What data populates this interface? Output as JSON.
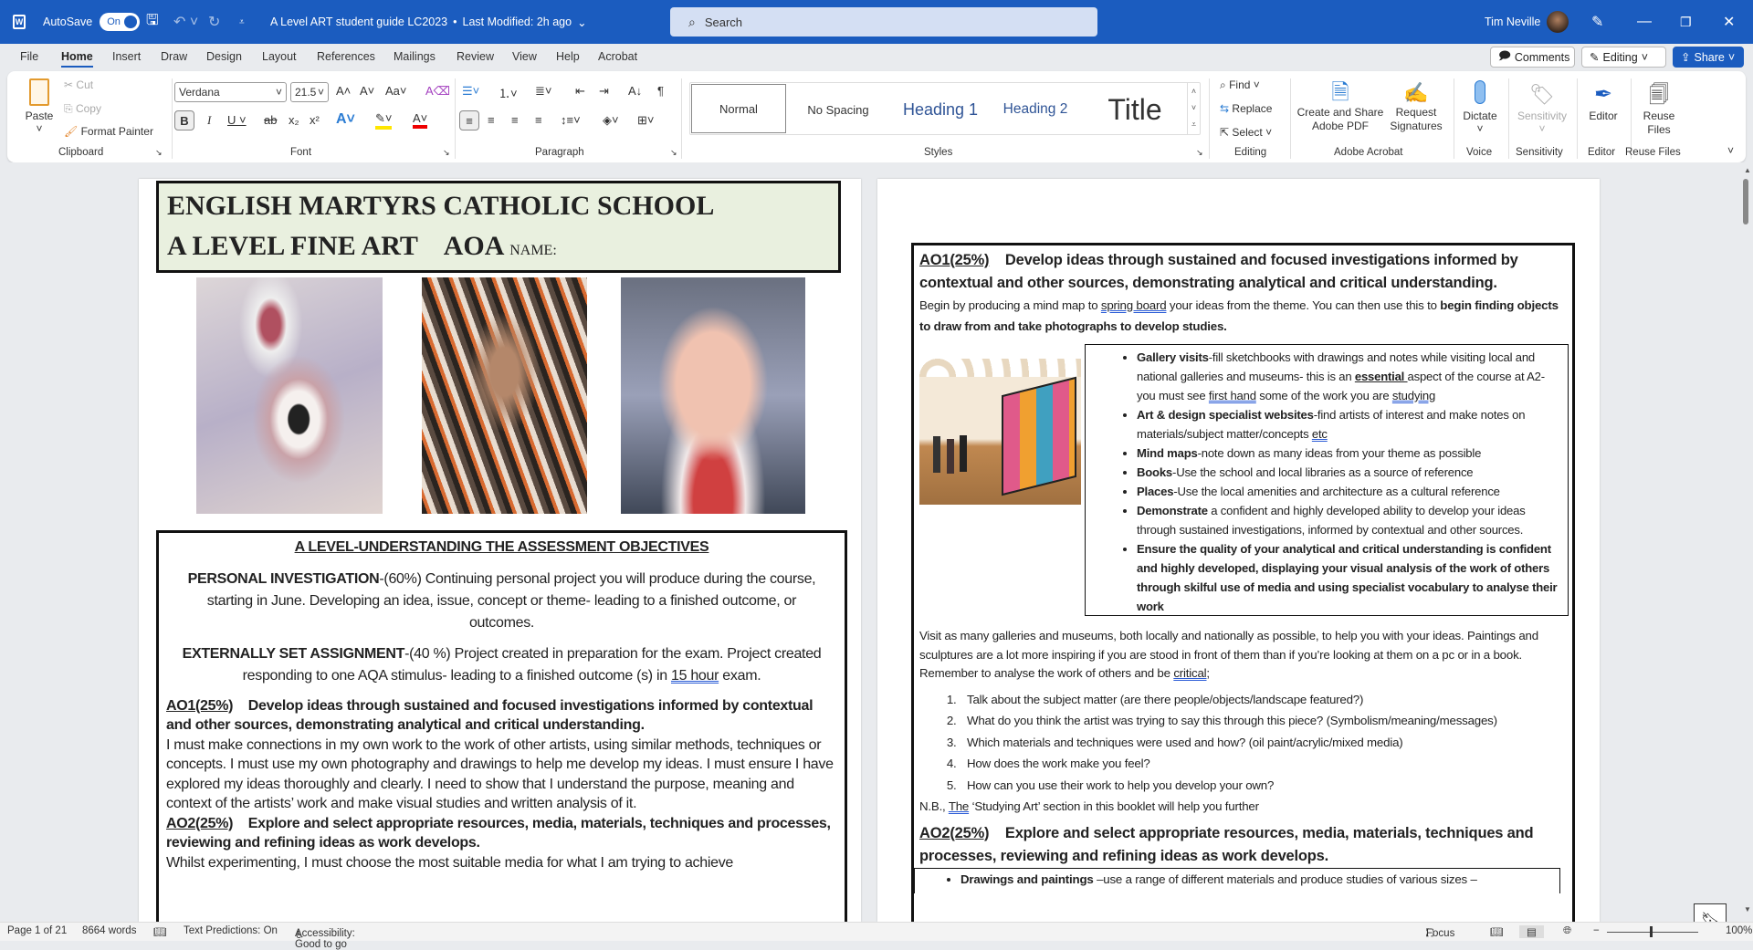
{
  "titlebar": {
    "autosave_label": "AutoSave",
    "autosave_state": "On",
    "doc_title": "A Level ART student guide LC2023",
    "modified": "Last Modified: 2h ago",
    "search_placeholder": "Search",
    "user": "Tim Neville"
  },
  "menu": {
    "tabs": [
      "File",
      "Home",
      "Insert",
      "Draw",
      "Design",
      "Layout",
      "References",
      "Mailings",
      "Review",
      "View",
      "Help",
      "Acrobat"
    ],
    "active": "Home",
    "comments": "Comments",
    "editing": "Editing",
    "share": "Share"
  },
  "ribbon": {
    "clipboard": {
      "paste": "Paste",
      "cut": "Cut",
      "copy": "Copy",
      "format_painter": "Format Painter",
      "label": "Clipboard"
    },
    "font": {
      "name": "Verdana",
      "size": "21.5",
      "label": "Font"
    },
    "paragraph": {
      "label": "Paragraph"
    },
    "styles": {
      "items": [
        "Normal",
        "No Spacing",
        "Heading 1",
        "Heading 2",
        "Title"
      ],
      "label": "Styles"
    },
    "editing": {
      "find": "Find",
      "replace": "Replace",
      "select": "Select",
      "label": "Editing"
    },
    "acrobat": {
      "create": "Create and Share Adobe PDF",
      "request": "Request Signatures",
      "label": "Adobe Acrobat"
    },
    "voice": {
      "dictate": "Dictate",
      "label": "Voice"
    },
    "sensitivity": {
      "button": "Sensitivity",
      "label": "Sensitivity"
    },
    "editor": {
      "button": "Editor",
      "label": "Editor"
    },
    "reuse": {
      "button": "Reuse Files",
      "label": "Reuse Files"
    }
  },
  "page1": {
    "school": "ENGLISH MARTYRS CATHOLIC SCHOOL",
    "course": "A LEVEL FINE ART",
    "board": "AOA",
    "name_label": "NAME:",
    "section_title": "A LEVEL-UNDERSTANDING THE ASSESSMENT OBJECTIVES",
    "pi_head": "PERSONAL INVESTIGATION",
    "pi_text": "-(60%) Continuing personal project you will produce during the course, starting in June. Developing an idea, issue, concept or theme- leading to a finished outcome, or outcomes.",
    "esa_head": "EXTERNALLY SET ASSIGNMENT",
    "esa_pct": "-(40 %)",
    "esa_text": " Project created in preparation for the exam. Project created responding to one AQA stimulus- leading to a finished outcome (s) in ",
    "esa_hours": "15 hour",
    "esa_end": " exam.",
    "ao1_code": "AO1(25%)",
    "ao1_title": "Develop ideas through sustained and focused investigations informed by contextual and other sources, demonstrating analytical and critical understanding.",
    "ao1_body": "I must make connections in my own work to the work of other artists, using similar methods, techniques or concepts.  I must use my own photography and drawings to help me develop my ideas.  I must ensure I have explored my ideas thoroughly and clearly.  I need to show that I understand the purpose, meaning and context of the artists’ work and make visual studies and written analysis of it.",
    "ao2_code": "AO2(25%)",
    "ao2_title": "Explore and select appropriate resources, media, materials, techniques and processes, reviewing and refining ideas as work develops.",
    "ao2_body": "Whilst experimenting, I must choose the most suitable media for what I am trying to achieve"
  },
  "page2": {
    "ao1_code": "AO1(25%)",
    "ao1_title": "Develop ideas through sustained and focused investigations informed by contextual and other sources, demonstrating analytical and critical understanding.",
    "intro_a": "Begin by producing a mind map to ",
    "intro_link": "spring board",
    "intro_b": " your ideas from the theme. You can then use this to ",
    "intro_bold": "begin finding objects to draw from and take photographs to develop studies.",
    "bullets": [
      {
        "head": "Gallery visits",
        "text": "-fill sketchbooks with drawings and notes while visiting local and national galleries and museums- this is an ",
        "em": "essential ",
        "text2": "aspect of the course at A2- you must see ",
        "sp1": "first hand",
        "text3": " some of the work you are ",
        "sp2": "studying"
      },
      {
        "head": "Art & design specialist websites",
        "text": "-find artists of interest and make notes on materials/subject matter/concepts ",
        "sp1": "etc"
      },
      {
        "head": "Mind maps",
        "text": "-note down as many ideas from your theme as possible"
      },
      {
        "head": "Books",
        "text": "-Use the school and local libraries as a source of reference"
      },
      {
        "head": "Places",
        "text": "-Use the local amenities and architecture as a cultural reference"
      },
      {
        "head": "Demonstrate",
        "text": " a confident and highly developed ability to develop your ideas through sustained investigations, informed by contextual and other sources."
      },
      {
        "head": "Ensure the quality of your analytical and critical understanding is confident and highly developed, displaying your visual analysis of the work of others through skilful use of media and using specialist vocabulary to analyse their work",
        "text": ""
      }
    ],
    "visit_text": "Visit as many galleries and museums, both locally and nationally as possible, to help you with your ideas. Paintings and sculptures are a lot more inspiring if you are stood in front of them than if you’re looking at them on a pc or in a book. Remember to analyse the work of others and be ",
    "visit_link": "critical;",
    "questions": [
      "Talk about the subject matter (are there people/objects/landscape featured?)",
      "What do you think the artist was trying to say this through this piece? (Symbolism/meaning/messages)",
      "Which materials and techniques were used and how? (oil paint/acrylic/mixed media)",
      "How does the work make you feel?",
      "How can you use their work to help you develop your own?"
    ],
    "nb_a": "N.B., ",
    "nb_the": "The",
    "nb_b": " ‘Studying Art’ section in this booklet will help you further",
    "ao2_code": "AO2(25%)",
    "ao2_title": "Explore and select appropriate resources, media, materials, techniques and processes, reviewing and refining ideas as work develops.",
    "ao2_bullet_head": "Drawings and paintings",
    "ao2_bullet_text": " –use a range of different materials and produce studies of various sizes –"
  },
  "status": {
    "page": "Page 1 of 21",
    "words": "8664 words",
    "predictions": "Text Predictions: On",
    "accessibility": "Accessibility: Good to go",
    "focus": "Focus",
    "zoom": "100%"
  },
  "colors": {
    "titlebar": "#1b5cbf",
    "header_box": "#e9f0df",
    "spell_underline": "#2b5cd6"
  }
}
